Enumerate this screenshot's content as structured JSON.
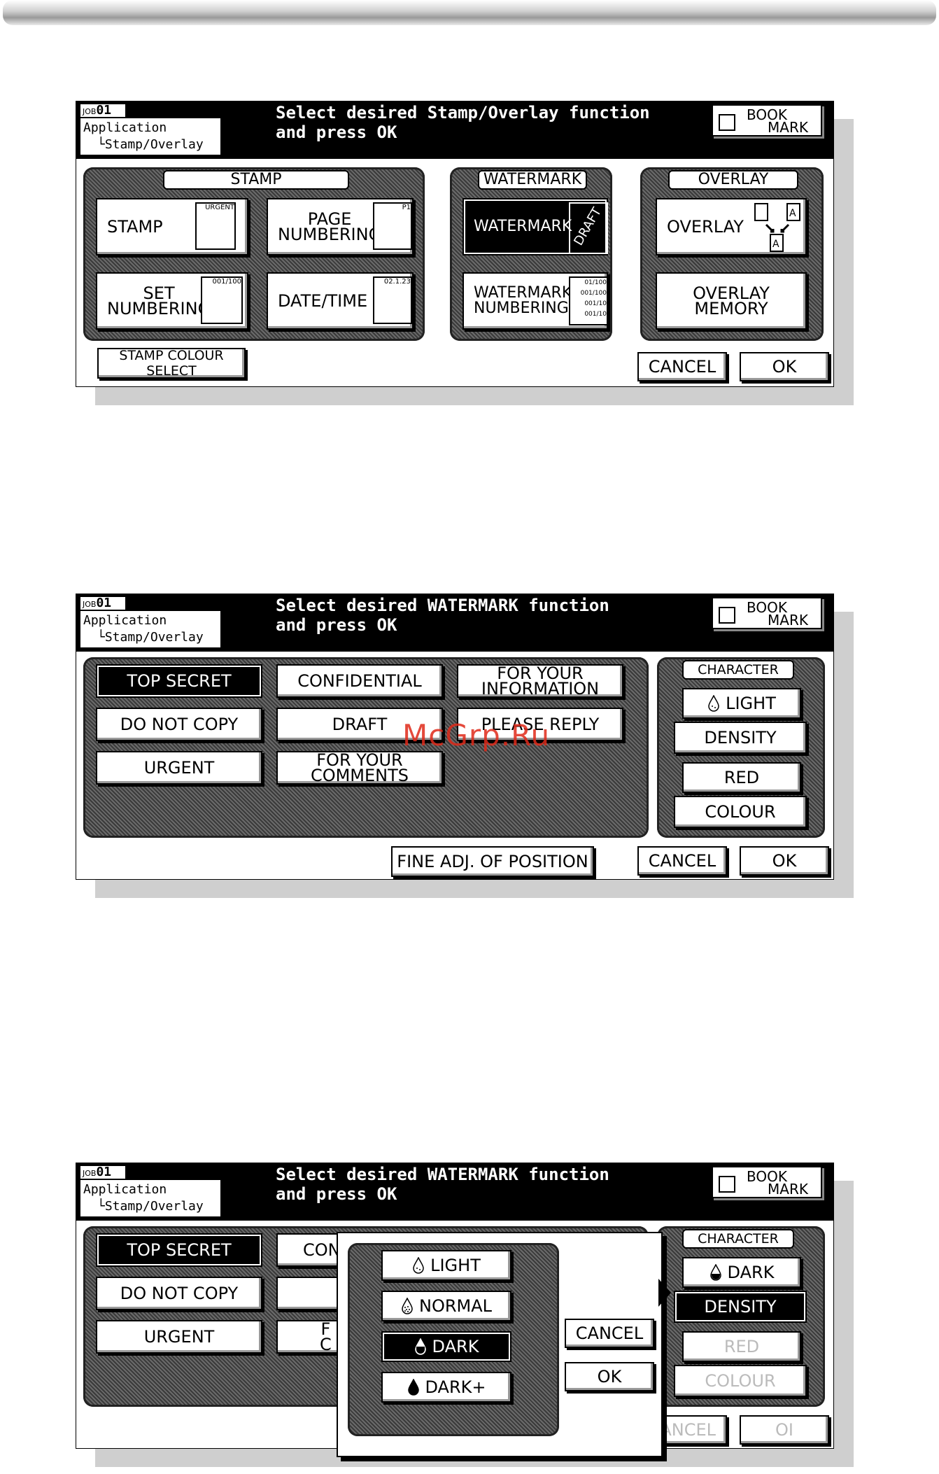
{
  "header": {
    "job_prefix": "JOB",
    "job_number": "01",
    "app_label": "Application",
    "app_sub": "└Stamp/Overlay",
    "bookmark_line1": "BOOK",
    "bookmark_line2": "MARK"
  },
  "screen1": {
    "title_line1": "Select desired Stamp/Overlay function",
    "title_line2": "and press OK",
    "stamp_group": "STAMP",
    "watermark_group": "WATERMARK",
    "overlay_group": "OVERLAY",
    "stamp_btn": "STAMP",
    "stamp_icon": "URGENT",
    "page_numbering_l1": "PAGE",
    "page_numbering_l2": "NUMBERING",
    "page_icon": "P1",
    "set_numbering_l1": "SET",
    "set_numbering_l2": "NUMBERING",
    "set_icon": "001/100",
    "datetime": "DATE/TIME",
    "date_icon": "02.1.23",
    "watermark_btn": "WATERMARK",
    "watermark_icon": "DRAFT",
    "wm_numbering_l1": "WATERMARK",
    "wm_numbering_l2": "NUMBERING",
    "wm_icon_lines": [
      "01/100",
      "001/100",
      "001/10",
      "001/10"
    ],
    "overlay_btn": "OVERLAY",
    "overlay_memory_l1": "OVERLAY",
    "overlay_memory_l2": "MEMORY",
    "colour_select": "STAMP COLOUR SELECT",
    "cancel": "CANCEL",
    "ok": "OK"
  },
  "screen2": {
    "title_line1": "Select desired WATERMARK function",
    "title_line2": "and press OK",
    "top_secret": "TOP SECRET",
    "confidential": "CONFIDENTIAL",
    "for_your_info_l1": "FOR YOUR",
    "for_your_info_l2": "INFORMATION",
    "do_not_copy": "DO NOT COPY",
    "draft": "DRAFT",
    "please_reply": "PLEASE REPLY",
    "urgent": "URGENT",
    "for_your_comments_l1": "FOR YOUR",
    "for_your_comments_l2": "COMMENTS",
    "character": "CHARACTER",
    "light": "LIGHT",
    "density": "DENSITY",
    "red": "RED",
    "colour": "COLOUR",
    "fine_adj": "FINE ADJ. OF POSITION",
    "cancel": "CANCEL",
    "ok": "OK",
    "site_watermark": "McGrp.Ru"
  },
  "screen3": {
    "title_line1": "Select desired WATERMARK function",
    "title_line2": "and press OK",
    "top_secret": "TOP SECRET",
    "do_not_copy": "DO NOT COPY",
    "urgent": "URGENT",
    "confidential_partial": "CON",
    "comments_partial_l1": "F",
    "comments_partial_l2": "C",
    "character": "CHARACTER",
    "dark": "DARK",
    "density": "DENSITY",
    "red": "RED",
    "colour": "COLOUR",
    "cancel_behind": "ANCEL",
    "ok_behind": "OI",
    "popup": {
      "light": "LIGHT",
      "normal": "NORMAL",
      "dark": "DARK",
      "dark_plus": "DARK+",
      "cancel": "CANCEL",
      "ok": "OK"
    }
  }
}
